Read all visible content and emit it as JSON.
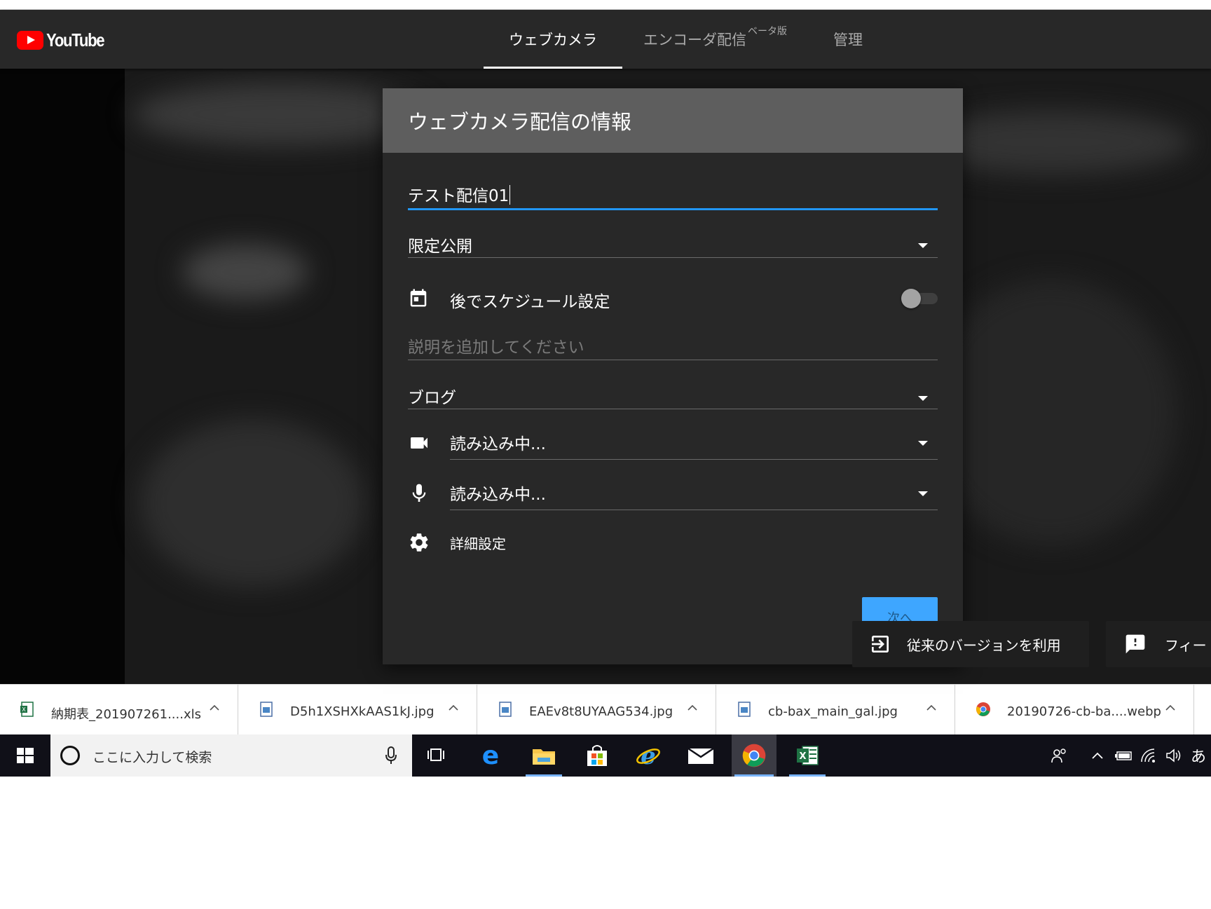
{
  "header": {
    "logo_text": "YouTube",
    "tabs": [
      {
        "label": "ウェブカメラ",
        "active": true
      },
      {
        "label": "エンコーダ配信",
        "badge": "ベータ版"
      },
      {
        "label": "管理"
      }
    ]
  },
  "dialog": {
    "title": "ウェブカメラ配信の情報",
    "stream_title_value": "テスト配信01",
    "privacy_value": "限定公開",
    "schedule_label": "後でスケジュール設定",
    "schedule_enabled": false,
    "description_placeholder": "説明を追加してください",
    "category_value": "ブログ",
    "camera_value": "読み込み中...",
    "mic_value": "読み込み中...",
    "advanced_label": "詳細設定",
    "next_label": "次へ",
    "accent_color": "#2196f3"
  },
  "floating": {
    "legacy_label": "従来のバージョンを利用",
    "feedback_label": "フィー"
  },
  "downloads": [
    {
      "name": "納期表_201907261....xls",
      "type": "excel-file-icon"
    },
    {
      "name": "D5h1XSHXkAAS1kJ.jpg",
      "type": "image-file-icon"
    },
    {
      "name": "EAEv8t8UYAAG534.jpg",
      "type": "image-file-icon"
    },
    {
      "name": "cb-bax_main_gal.jpg",
      "type": "image-file-icon"
    },
    {
      "name": "20190726-cb-ba....webp",
      "type": "chrome-file-icon"
    }
  ],
  "taskbar": {
    "search_placeholder": "ここに入力して検索",
    "ime_indicator": "あ"
  }
}
